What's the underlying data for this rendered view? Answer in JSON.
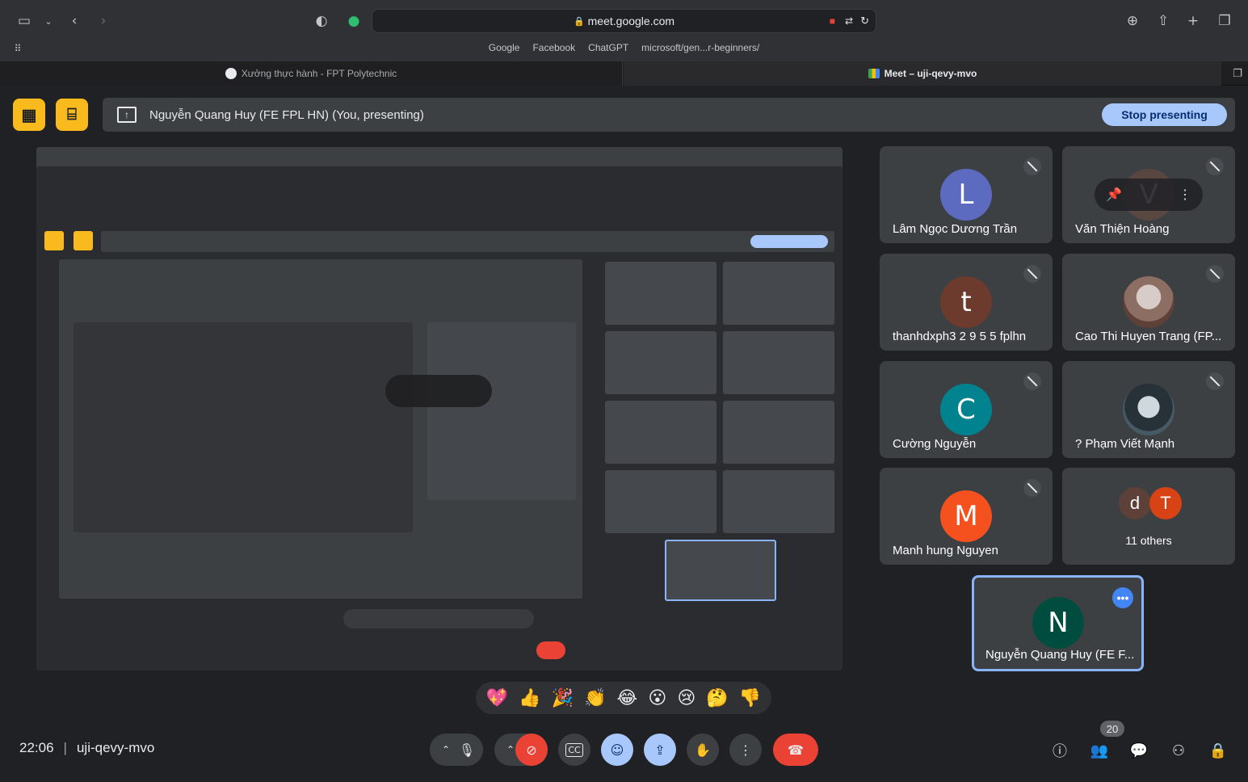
{
  "browser": {
    "url": "meet.google.com",
    "bookmarks": [
      "Google",
      "Facebook",
      "ChatGPT",
      "microsoft/gen...r-beginners/"
    ],
    "tabs": [
      {
        "label": "Xưởng thực hành - FPT Polytechnic",
        "active": false
      },
      {
        "label": "Meet – uji-qevy-mvo",
        "active": true
      }
    ]
  },
  "presenting_bar": {
    "text": "Nguyễn Quang Huy (FE FPL HN) (You, presenting)",
    "stop_label": "Stop presenting"
  },
  "participants": [
    {
      "name": "Lâm Ngọc Dương Trần",
      "initial": "L",
      "color": "#5c6bc0",
      "muted": true
    },
    {
      "name": "Văn Thiện Hoàng",
      "initial": "V",
      "color": "#6d4c41",
      "muted": true
    },
    {
      "name": "thanhdxph3 2 9 5 5 fplhn",
      "initial": "t",
      "color": "#6d3a2e",
      "muted": true
    },
    {
      "name": "Cao Thi Huyen Trang (FP...",
      "initial": "",
      "color": "#8d6e63",
      "muted": true
    },
    {
      "name": "Cường Nguyễn",
      "initial": "C",
      "color": "#00838f",
      "muted": true
    },
    {
      "name": "? Phạm Viết Mạnh",
      "initial": "",
      "color": "#37474f",
      "muted": true
    },
    {
      "name": "Manh hung Nguyen",
      "initial": "M",
      "color": "#f4511e",
      "muted": true
    },
    {
      "name": "11 others",
      "initial": "",
      "color": "",
      "muted": false
    }
  ],
  "others_initials": [
    "d",
    "T"
  ],
  "self_tile": {
    "name": "Nguyễn Quang Huy (FE F...",
    "initial": "N"
  },
  "reactions": [
    "💖",
    "👍",
    "🎉",
    "👏",
    "😂",
    "😮",
    "😢",
    "🤔",
    "👎"
  ],
  "bottom": {
    "time": "22:06",
    "meeting_code": "uji-qevy-mvo",
    "participant_count": "20"
  },
  "colors": {
    "accent": "#a8c7fa",
    "end_call": "#ea4335",
    "yellow": "#f9ba1e",
    "self_border": "#8ab4f8"
  }
}
